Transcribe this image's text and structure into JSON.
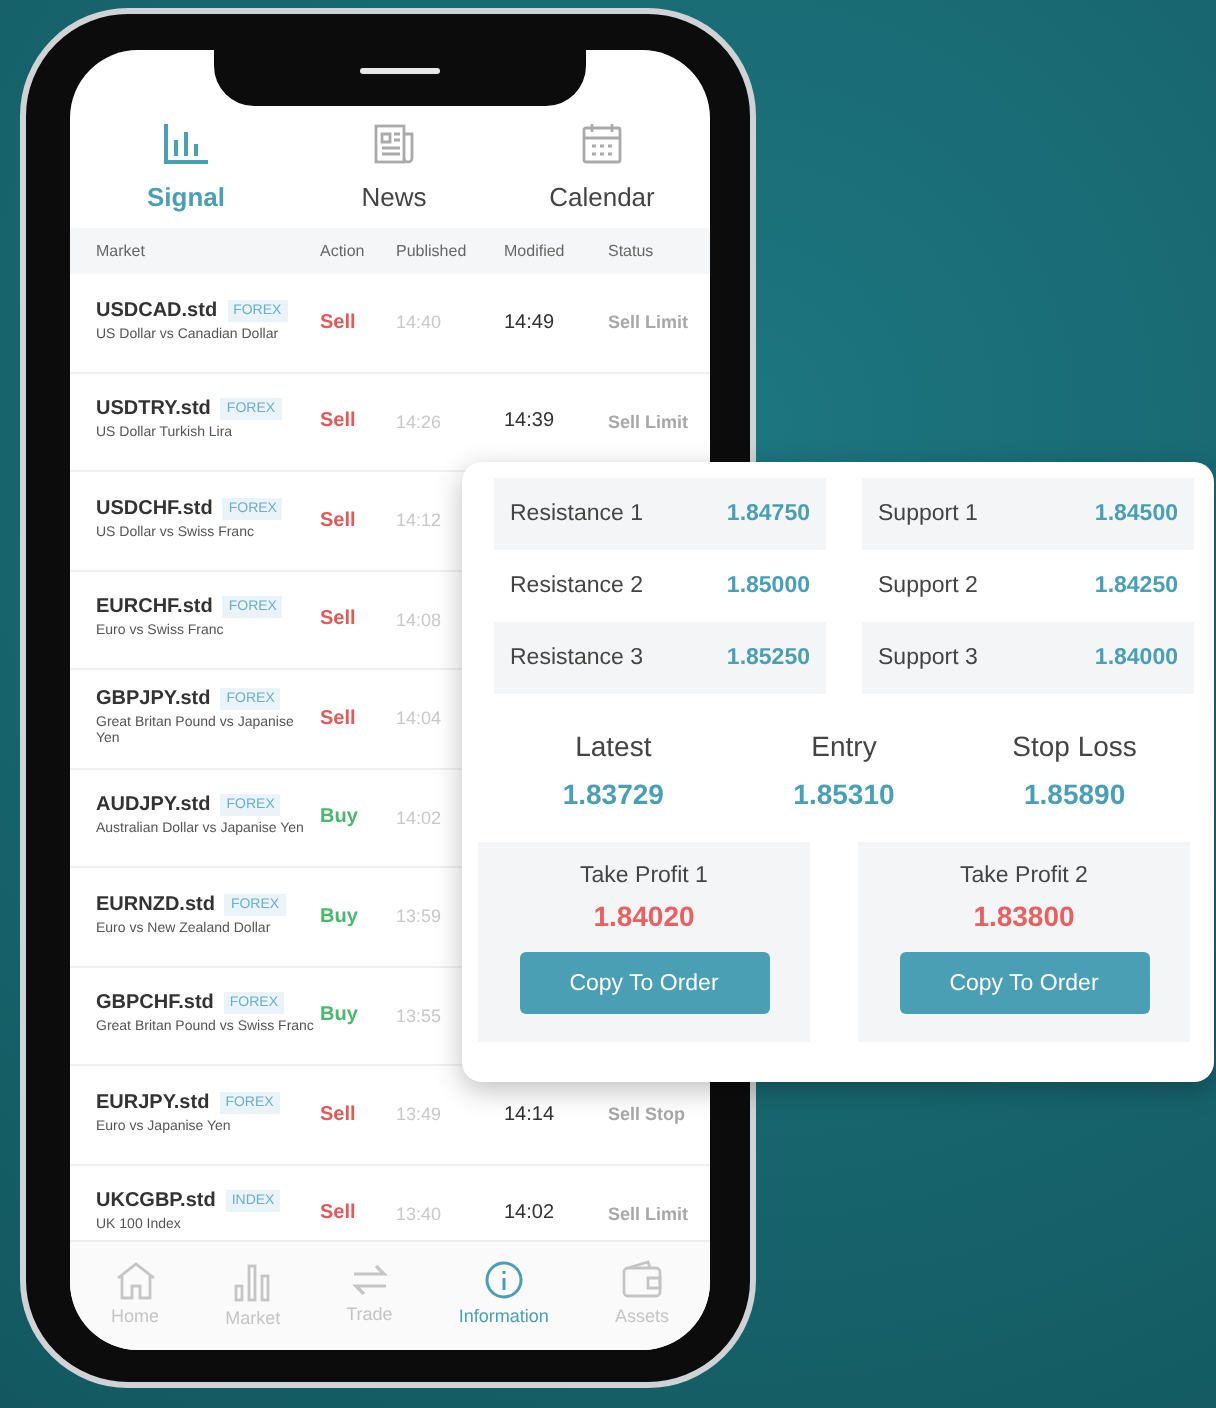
{
  "tabs": [
    {
      "label": "Signal",
      "kind": "chart",
      "selected": true
    },
    {
      "label": "News",
      "kind": "news",
      "selected": false
    },
    {
      "label": "Calendar",
      "kind": "calendar",
      "selected": false
    }
  ],
  "columns": [
    "Market",
    "Action",
    "Published",
    "Modified",
    "Status"
  ],
  "rows": [
    {
      "symbol": "USDCAD.std",
      "tag": "FOREX",
      "name": "US Dollar vs Canadian Dollar",
      "action": "Sell",
      "kind": "sell",
      "published": "14:40",
      "modified": "14:49",
      "status": "Sell Limit"
    },
    {
      "symbol": "USDTRY.std",
      "tag": "FOREX",
      "name": "US Dollar Turkish Lira",
      "action": "Sell",
      "kind": "sell",
      "published": "14:26",
      "modified": "14:39",
      "status": "Sell Limit"
    },
    {
      "symbol": "USDCHF.std",
      "tag": "FOREX",
      "name": "US Dollar vs Swiss Franc",
      "action": "Sell",
      "kind": "sell",
      "published": "14:12"
    },
    {
      "symbol": "EURCHF.std",
      "tag": "FOREX",
      "name": "Euro vs Swiss Franc",
      "action": "Sell",
      "kind": "sell",
      "published": "14:08"
    },
    {
      "symbol": "GBPJPY.std",
      "tag": "FOREX",
      "name": "Great Britan Pound vs Japanise Yen",
      "action": "Sell",
      "kind": "sell",
      "published": "14:04"
    },
    {
      "symbol": "AUDJPY.std",
      "tag": "FOREX",
      "name": "Australian Dollar vs Japanise Yen",
      "action": "Buy",
      "kind": "buy",
      "published": "14:02"
    },
    {
      "symbol": "EURNZD.std",
      "tag": "FOREX",
      "name": "Euro vs New Zealand Dollar",
      "action": "Buy",
      "kind": "buy",
      "published": "13:59"
    },
    {
      "symbol": "GBPCHF.std",
      "tag": "FOREX",
      "name": "Great Britan Pound vs Swiss Franc",
      "action": "Buy",
      "kind": "buy",
      "published": "13:55"
    },
    {
      "symbol": "EURJPY.std",
      "tag": "FOREX",
      "name": "Euro vs Japanise Yen",
      "action": "Sell",
      "kind": "sell",
      "published": "13:49",
      "modified": "14:14",
      "status": "Sell Stop"
    },
    {
      "symbol": "UKCGBP.std",
      "tag": "INDEX",
      "name": "UK 100 Index",
      "action": "Sell",
      "kind": "sell",
      "published": "13:40",
      "modified": "14:02",
      "status": "Sell Limit"
    }
  ],
  "nav": [
    {
      "label": "Home",
      "kind": "home",
      "selected": false
    },
    {
      "label": "Market",
      "kind": "bars",
      "selected": false
    },
    {
      "label": "Trade",
      "kind": "swap",
      "selected": false
    },
    {
      "label": "Information",
      "kind": "info",
      "selected": true
    },
    {
      "label": "Assets",
      "kind": "wallet",
      "selected": false
    }
  ],
  "levels": [
    {
      "label": "Resistance 1",
      "value": "1.84750",
      "label_2": "Support 1",
      "value_2": "1.84500"
    },
    {
      "label": "Resistance 2",
      "value": "1.85000",
      "label_2": "Support 2",
      "value_2": "1.84250"
    },
    {
      "label": "Resistance 3",
      "value": "1.85250",
      "label_2": "Support 3",
      "value_2": "1.84000"
    }
  ],
  "prices": [
    {
      "label": "Latest",
      "value": "1.83729"
    },
    {
      "label": "Entry",
      "value": "1.85310"
    },
    {
      "label": "Stop Loss",
      "value": "1.85890"
    }
  ],
  "targets": [
    {
      "label": "Take Profit 1",
      "value": "1.84020",
      "button": "Copy To Order"
    },
    {
      "label": "Take Profit 2",
      "value": "1.83800",
      "button": "Copy To Order"
    }
  ]
}
